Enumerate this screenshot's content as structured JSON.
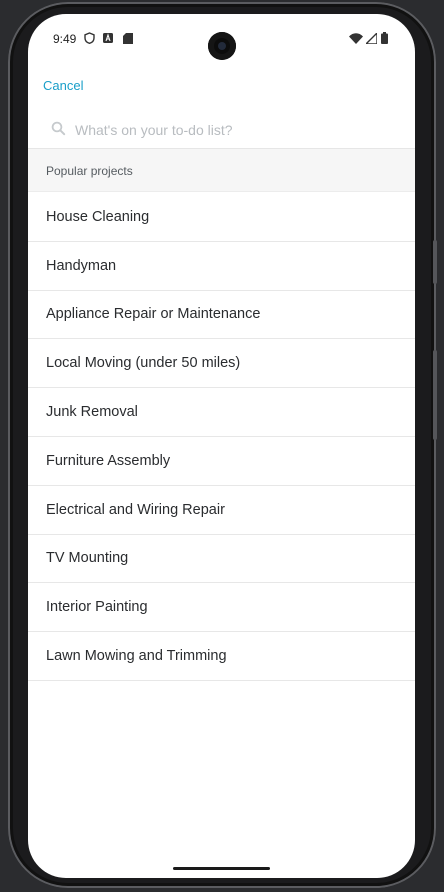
{
  "status_bar": {
    "time": "9:49",
    "left_icons": [
      "shield-icon",
      "a-icon",
      "sd-card-icon"
    ],
    "right_icons": [
      "wifi-icon",
      "signal-icon",
      "battery-icon"
    ]
  },
  "header": {
    "cancel_label": "Cancel"
  },
  "search": {
    "placeholder": "What's on your to-do list?",
    "value": ""
  },
  "section": {
    "title": "Popular projects"
  },
  "projects": [
    "House Cleaning",
    "Handyman",
    "Appliance Repair or Maintenance",
    "Local Moving (under 50 miles)",
    "Junk Removal",
    "Furniture Assembly",
    "Electrical and Wiring Repair",
    "TV Mounting",
    "Interior Painting",
    "Lawn Mowing and Trimming"
  ],
  "colors": {
    "accent": "#1a9fc9",
    "text": "#2a2c2f",
    "section_bg": "#f6f6f6"
  }
}
